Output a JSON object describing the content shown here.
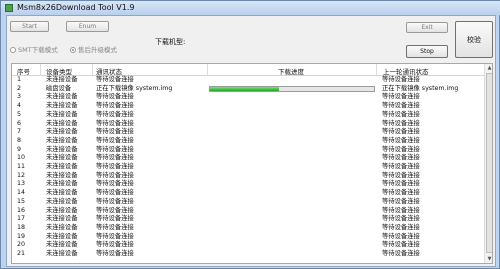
{
  "window": {
    "title": "Msm8x26Download Tool V1.9"
  },
  "toolbar": {
    "start_label": "Start",
    "enum_label": "Enum",
    "exit_label": "Exit",
    "stop_label": "Stop",
    "verify_label": "校验",
    "model_label": "下载机型:"
  },
  "modes": {
    "smt_label": "SMT下载模式",
    "after_sales_label": "售后升级模式",
    "selected": "售后升级模式"
  },
  "table": {
    "headers": [
      "序号",
      "设备类型",
      "通讯状态",
      "下载进度",
      "上一轮通讯状态"
    ],
    "rows": [
      {
        "idx": "1",
        "type": "未连接设备",
        "status": "等待设备连接",
        "progress": null,
        "last": "等待设备连接"
      },
      {
        "idx": "2",
        "type": "磁盘设备",
        "status": "正在下载镜像 system.img",
        "progress": 0.42,
        "last": "正在下载镜像 system.img"
      },
      {
        "idx": "3",
        "type": "未连接设备",
        "status": "等待设备连接",
        "progress": null,
        "last": "等待设备连接"
      },
      {
        "idx": "4",
        "type": "未连接设备",
        "status": "等待设备连接",
        "progress": null,
        "last": "等待设备连接"
      },
      {
        "idx": "5",
        "type": "未连接设备",
        "status": "等待设备连接",
        "progress": null,
        "last": "等待设备连接"
      },
      {
        "idx": "6",
        "type": "未连接设备",
        "status": "等待设备连接",
        "progress": null,
        "last": "等待设备连接"
      },
      {
        "idx": "7",
        "type": "未连接设备",
        "status": "等待设备连接",
        "progress": null,
        "last": "等待设备连接"
      },
      {
        "idx": "8",
        "type": "未连接设备",
        "status": "等待设备连接",
        "progress": null,
        "last": "等待设备连接"
      },
      {
        "idx": "9",
        "type": "未连接设备",
        "status": "等待设备连接",
        "progress": null,
        "last": "等待设备连接"
      },
      {
        "idx": "10",
        "type": "未连接设备",
        "status": "等待设备连接",
        "progress": null,
        "last": "等待设备连接"
      },
      {
        "idx": "11",
        "type": "未连接设备",
        "status": "等待设备连接",
        "progress": null,
        "last": "等待设备连接"
      },
      {
        "idx": "12",
        "type": "未连接设备",
        "status": "等待设备连接",
        "progress": null,
        "last": "等待设备连接"
      },
      {
        "idx": "13",
        "type": "未连接设备",
        "status": "等待设备连接",
        "progress": null,
        "last": "等待设备连接"
      },
      {
        "idx": "14",
        "type": "未连接设备",
        "status": "等待设备连接",
        "progress": null,
        "last": "等待设备连接"
      },
      {
        "idx": "15",
        "type": "未连接设备",
        "status": "等待设备连接",
        "progress": null,
        "last": "等待设备连接"
      },
      {
        "idx": "16",
        "type": "未连接设备",
        "status": "等待设备连接",
        "progress": null,
        "last": "等待设备连接"
      },
      {
        "idx": "17",
        "type": "未连接设备",
        "status": "等待设备连接",
        "progress": null,
        "last": "等待设备连接"
      },
      {
        "idx": "18",
        "type": "未连接设备",
        "status": "等待设备连接",
        "progress": null,
        "last": "等待设备连接"
      },
      {
        "idx": "19",
        "type": "未连接设备",
        "status": "等待设备连接",
        "progress": null,
        "last": "等待设备连接"
      },
      {
        "idx": "20",
        "type": "未连接设备",
        "status": "等待设备连接",
        "progress": null,
        "last": "等待设备连接"
      },
      {
        "idx": "21",
        "type": "未连接设备",
        "status": "等待设备连接",
        "progress": null,
        "last": "等待设备连接"
      }
    ]
  },
  "icons": {
    "app": "app-icon",
    "scroll_up": "scroll-up-icon",
    "scroll_down": "scroll-down-icon"
  },
  "colors": {
    "progress_fill": "#1fa81f",
    "window_frame": "#bcd4ee"
  }
}
